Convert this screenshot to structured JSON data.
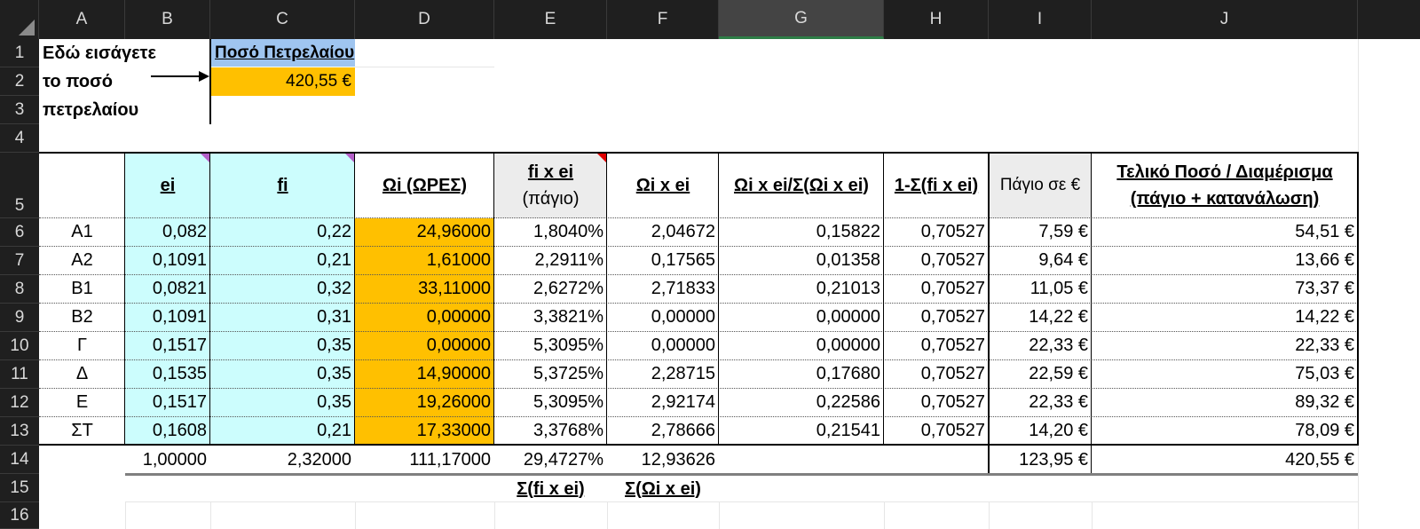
{
  "columns": [
    "A",
    "B",
    "C",
    "D",
    "E",
    "F",
    "G",
    "H",
    "I",
    "J"
  ],
  "selected_column": "G",
  "rows": [
    "1",
    "2",
    "3",
    "4",
    "5",
    "6",
    "7",
    "8",
    "9",
    "10",
    "11",
    "12",
    "13",
    "14",
    "15",
    "16"
  ],
  "note": {
    "line1": "Εδώ εισάγετε",
    "line2": "το ποσό",
    "line3": "πετρελαίου"
  },
  "input": {
    "label": "Ποσό Πετρελαίου",
    "value": "420,55 €"
  },
  "headers": {
    "ei": "ei",
    "fi": "fi",
    "omega": "Ωi (ΩΡΕΣ)",
    "fixei_top": "fi x ei",
    "fixei_bottom": "(πάγιο)",
    "omegaxei": "Ωi x ei",
    "ratio": "Ωi x ei/Σ(Ωi x ei)",
    "one_minus": "1-Σ(fi x ei)",
    "pagio": "Πάγιο σε €",
    "final_top": "Τελικό Ποσό / Διαμέρισμα",
    "final_bottom": "(πάγιο + κατανάλωση)"
  },
  "data": [
    [
      "Α1",
      "0,082",
      "0,22",
      "24,96000",
      "1,8040%",
      "2,04672",
      "0,15822",
      "0,70527",
      "7,59 €",
      "54,51 €"
    ],
    [
      "Α2",
      "0,1091",
      "0,21",
      "1,61000",
      "2,2911%",
      "0,17565",
      "0,01358",
      "0,70527",
      "9,64 €",
      "13,66 €"
    ],
    [
      "Β1",
      "0,0821",
      "0,32",
      "33,11000",
      "2,6272%",
      "2,71833",
      "0,21013",
      "0,70527",
      "11,05 €",
      "73,37 €"
    ],
    [
      "Β2",
      "0,1091",
      "0,31",
      "0,00000",
      "3,3821%",
      "0,00000",
      "0,00000",
      "0,70527",
      "14,22 €",
      "14,22 €"
    ],
    [
      "Γ",
      "0,1517",
      "0,35",
      "0,00000",
      "5,3095%",
      "0,00000",
      "0,00000",
      "0,70527",
      "22,33 €",
      "22,33 €"
    ],
    [
      "Δ",
      "0,1535",
      "0,35",
      "14,90000",
      "5,3725%",
      "2,28715",
      "0,17680",
      "0,70527",
      "22,59 €",
      "75,03 €"
    ],
    [
      "Ε",
      "0,1517",
      "0,35",
      "19,26000",
      "5,3095%",
      "2,92174",
      "0,22586",
      "0,70527",
      "22,33 €",
      "89,32 €"
    ],
    [
      "ΣΤ",
      "0,1608",
      "0,21",
      "17,33000",
      "3,3768%",
      "2,78666",
      "0,21541",
      "0,70527",
      "14,20 €",
      "78,09 €"
    ]
  ],
  "totals": {
    "ei": "1,00000",
    "fi": "2,32000",
    "omega": "111,17000",
    "fixei": "29,4727%",
    "omegaxei": "12,93626",
    "pagio": "123,95 €",
    "final": "420,55 €"
  },
  "footer": {
    "sum_fixei": "Σ(fi x ei)",
    "sum_omegaxei": "Σ(Ωi x ei)"
  },
  "colors": {
    "input_cells": "#ccfdfd",
    "hours_cells": "#ffc000",
    "label_header": "#9fc5f0",
    "grey_header": "#ececec"
  }
}
